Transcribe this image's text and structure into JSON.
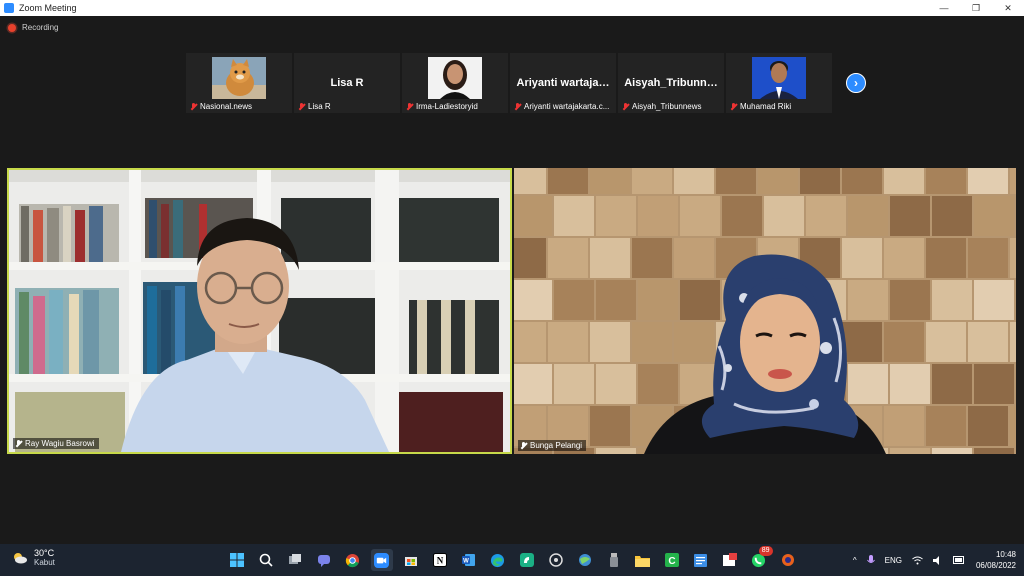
{
  "window": {
    "title": "Zoom Meeting",
    "controls": [
      "—",
      "❐",
      "✕"
    ]
  },
  "recording": {
    "label": "Recording"
  },
  "gallery": [
    {
      "caption": "Nasional.news",
      "display_name": "",
      "has_video": true,
      "photo": "cat-icon"
    },
    {
      "caption": "Lisa R",
      "display_name": "Lisa R",
      "has_video": false
    },
    {
      "caption": "Irma-Ladiestoryid",
      "display_name": "",
      "has_video": true,
      "photo": "woman-portrait"
    },
    {
      "caption": "Ariyanti wartajakarta.c...",
      "display_name": "Ariyanti  wartaja…",
      "has_video": false
    },
    {
      "caption": "Aisyah_Tribunnews",
      "display_name": "Aisyah_Tribunn…",
      "has_video": false
    },
    {
      "caption": "Muhamad Riki",
      "display_name": "",
      "has_video": true,
      "photo": "man-portrait-blue"
    }
  ],
  "next_page_icon": "chevron-right-icon",
  "speakers": [
    {
      "name": "Ray Wagiu Basrowi",
      "active_speaker": true
    },
    {
      "name": "Bunga Pelangi",
      "active_speaker": false
    }
  ],
  "colors": {
    "active_speaker_border": "#c7d94a",
    "accent": "#2d8cff",
    "muted_mic": "#e33333",
    "taskbar": "#1c2430"
  },
  "taskbar": {
    "weather": {
      "temp": "30°C",
      "desc": "Kabut"
    },
    "apps": [
      "windows-start-icon",
      "search-icon",
      "task-view-icon",
      "teams-chat-icon",
      "chrome-icon",
      "zoom-icon",
      "store-icon",
      "notion-icon",
      "word-icon",
      "edge-icon",
      "app-green-icon",
      "photos-icon",
      "browser-globe-icon",
      "usb-icon",
      "file-explorer-icon",
      "camtasia-icon",
      "notepad-icon",
      "paint-icon",
      "whatsapp-icon",
      "media-icon"
    ],
    "whatsapp_badge": "89",
    "tray": {
      "language": "ENG",
      "time": "10:48",
      "date": "06/08/2022"
    }
  }
}
